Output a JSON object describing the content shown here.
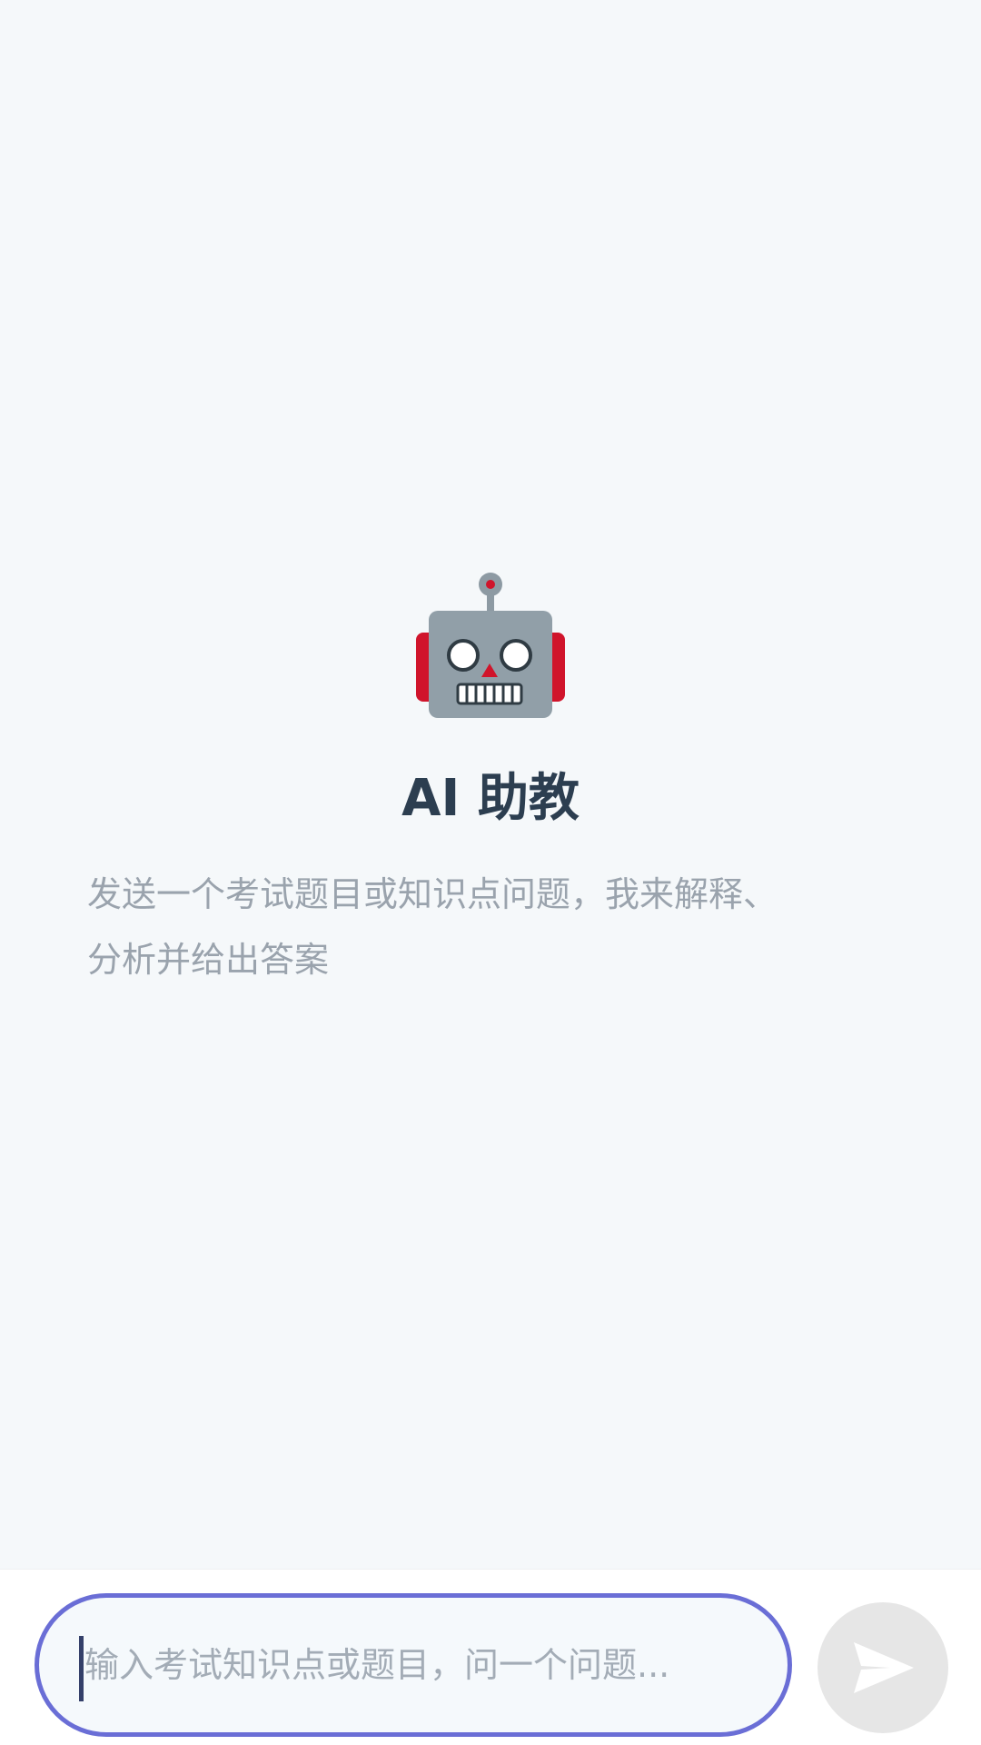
{
  "empty_state": {
    "icon": "robot-icon",
    "title": "AI 助教",
    "subtitle_line1": "发送一个考试题目或知识点问题，我来解释、",
    "subtitle_line2": "分析并给出答案"
  },
  "input": {
    "placeholder": "输入考试知识点或题目，问一个问题...",
    "value": ""
  },
  "send_button": {
    "icon": "send-icon",
    "state": "disabled"
  },
  "colors": {
    "background": "#f5f8fa",
    "title": "#2c3e50",
    "subtitle": "#9aa3ad",
    "input_border": "#6a6ed6",
    "send_button_bg": "#e6e6e6"
  }
}
